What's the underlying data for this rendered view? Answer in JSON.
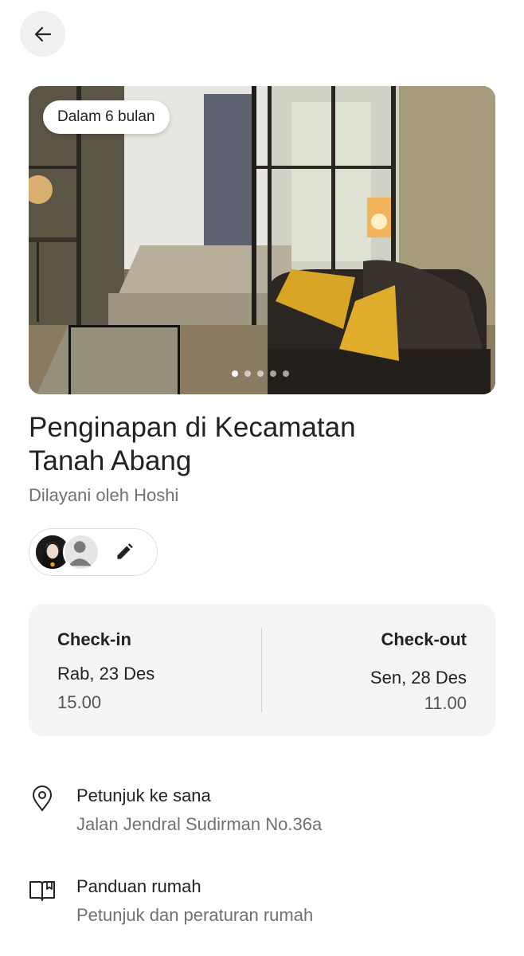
{
  "hero": {
    "badge": "Dalam 6 bulan",
    "image_count": 5,
    "active_index": 0
  },
  "listing": {
    "title_line1": "Penginapan di Kecamatan",
    "title_line2": "Tanah Abang",
    "host": "Dilayani oleh Hoshi"
  },
  "dates": {
    "checkin_label": "Check-in",
    "checkin_day": "Rab, 23 Des",
    "checkin_time": "15.00",
    "checkout_label": "Check-out",
    "checkout_day": "Sen, 28 Des",
    "checkout_time": "11.00"
  },
  "rows": {
    "directions_label": "Petunjuk ke sana",
    "directions_address": "Jalan Jendral Sudirman No.36a",
    "manual_label": "Panduan rumah",
    "manual_desc": "Petunjuk dan peraturan rumah"
  },
  "icons": {
    "back": "arrow-left-icon",
    "edit": "pencil-icon",
    "location": "location-pin-icon",
    "manual": "open-book-icon"
  }
}
